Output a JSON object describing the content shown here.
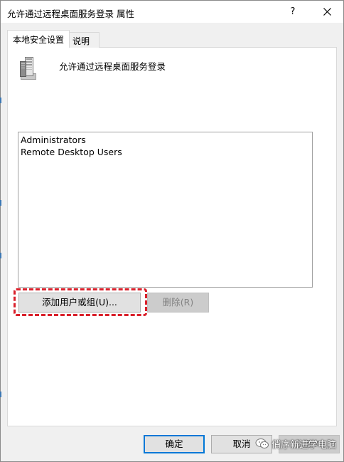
{
  "window": {
    "title": "允许通过远程桌面服务登录 属性",
    "help_label": "?",
    "close_icon": "close-icon"
  },
  "tabs": [
    {
      "label": "本地安全设置",
      "active": true
    },
    {
      "label": "说明",
      "active": false
    }
  ],
  "policy": {
    "icon": "server-icon",
    "name": "允许通过远程桌面服务登录"
  },
  "members": [
    "Administrators",
    "Remote Desktop Users"
  ],
  "buttons": {
    "add_label": "添加用户或组(U)...",
    "remove_label": "删除(R)",
    "ok_label": "确定",
    "cancel_label": "取消",
    "apply_label": "应用(A)"
  },
  "annotation": {
    "highlight_color": "#d9202b"
  },
  "watermark": {
    "logo": "wechat-logo",
    "text": "俏序新进学电脑"
  },
  "colors": {
    "accent": "#0078d7",
    "dialog_bg": "#f0f0f0",
    "panel_bg": "#ffffff"
  }
}
